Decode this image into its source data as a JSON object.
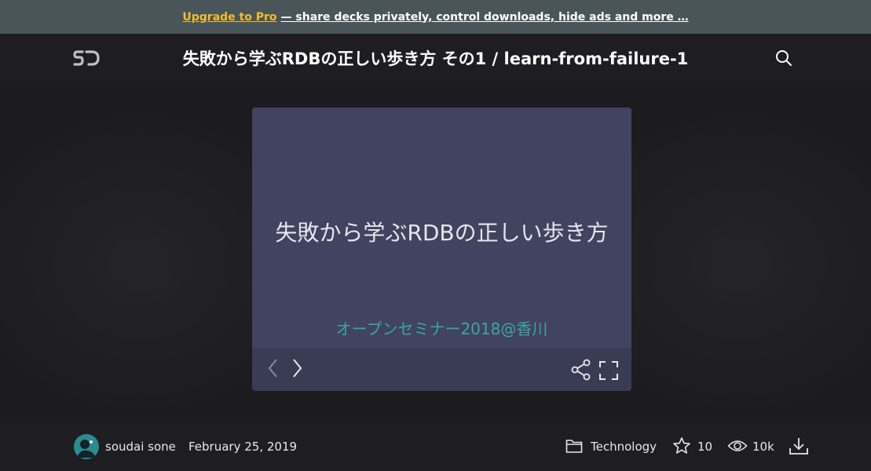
{
  "promo": {
    "link_label": "Upgrade to Pro",
    "text": "— share decks privately, control downloads, hide ads and more …"
  },
  "header": {
    "logo_text": "SD",
    "title": "失敗から学ぶRDBの正しい歩き方 その1 / learn-from-failure-1"
  },
  "slide": {
    "title": "失敗から学ぶRDBの正しい歩き方",
    "subtitle": "オープンセミナー2018@香川"
  },
  "footer": {
    "author": "soudai sone",
    "date": "February 25, 2019",
    "category": "Technology",
    "stars": "10",
    "views": "10k"
  },
  "colors": {
    "promo_bg": "#4a5559",
    "promo_link": "#f4bd2a",
    "slide_bg": "#424360",
    "slide_subtitle": "#3aa6a0",
    "page_bg": "#1c1c20"
  },
  "icons": [
    "logo-icon",
    "search-icon",
    "chevron-left-icon",
    "chevron-right-icon",
    "share-icon",
    "fullscreen-icon",
    "folder-icon",
    "star-icon",
    "eye-icon",
    "download-icon"
  ]
}
